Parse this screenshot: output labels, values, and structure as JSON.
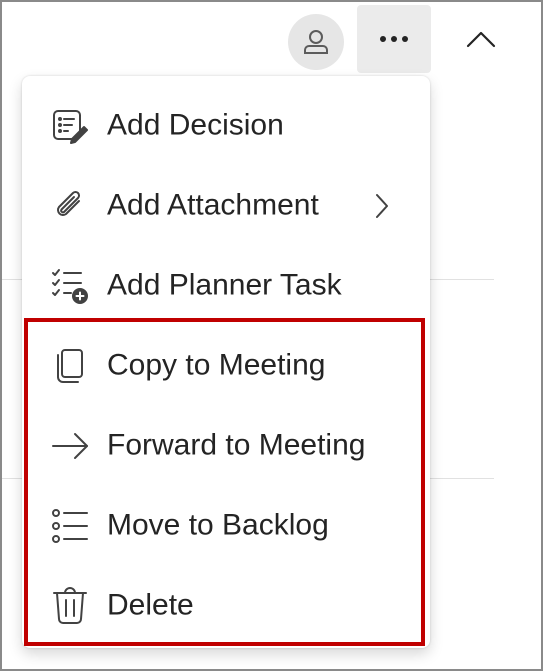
{
  "toolbar": {
    "avatar_icon": "person-icon",
    "more_icon": "more-horizontal-icon",
    "collapse_icon": "chevron-up-icon"
  },
  "menu": {
    "items": [
      {
        "label": "Add Decision",
        "icon": "decision-icon"
      },
      {
        "label": "Add Attachment",
        "icon": "attach-icon",
        "has_submenu": true
      },
      {
        "label": "Add Planner Task",
        "icon": "planner-task-add-icon"
      },
      {
        "label": "Copy to Meeting",
        "icon": "copy-icon"
      },
      {
        "label": "Forward to Meeting",
        "icon": "arrow-right-icon"
      },
      {
        "label": "Move to Backlog",
        "icon": "list-icon"
      },
      {
        "label": "Delete",
        "icon": "trash-icon"
      }
    ]
  },
  "colors": {
    "highlight": "#c00000",
    "text": "#242424",
    "icon": "#424242"
  }
}
